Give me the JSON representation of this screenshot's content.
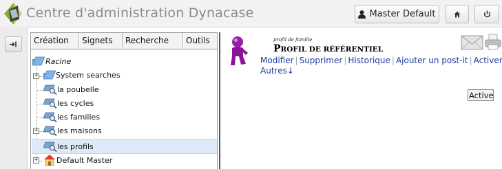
{
  "header": {
    "app_title": "Centre d'administration Dynacase",
    "user_label": "Master Default",
    "icons": {
      "user": "user-icon",
      "home": "home-icon",
      "power": "power-icon",
      "logo": "dynacase-logo-icon"
    }
  },
  "left_column": {
    "toggle_icon": "expand-panel-icon"
  },
  "tree": {
    "menu": [
      "Création",
      "Signets",
      "Recherche",
      "Outils"
    ],
    "root": "Racine",
    "nodes": [
      {
        "label": "System searches",
        "icon": "folder-icon",
        "expandable": true
      },
      {
        "label": "la poubelle",
        "icon": "search-folder-icon",
        "expandable": false
      },
      {
        "label": "les cycles",
        "icon": "search-folder-icon",
        "expandable": false
      },
      {
        "label": "les familles",
        "icon": "search-folder-icon",
        "expandable": false
      },
      {
        "label": "les maisons",
        "icon": "search-folder-icon",
        "expandable": true
      },
      {
        "label": "les profils",
        "icon": "search-folder-icon",
        "expandable": false,
        "selected": true
      },
      {
        "label": "Default Master",
        "icon": "user-home-icon",
        "expandable": true
      }
    ]
  },
  "document": {
    "caption": "profil de famille",
    "title_first": "P",
    "title_rest": "ROFIL DE RÉFÉRENTIEL",
    "actions": [
      "Modifier",
      "Supprimer",
      "Historique",
      "Ajouter un post-it",
      "Activer"
    ],
    "more": "Autres↓",
    "activate_button": "Activer",
    "icons": {
      "family": "family-profile-icon",
      "mail": "mail-icon",
      "print": "print-icon"
    }
  },
  "colors": {
    "link": "#1c3a9a",
    "selected_row": "#dde9f7",
    "title_grey": "#8a8a8a"
  }
}
